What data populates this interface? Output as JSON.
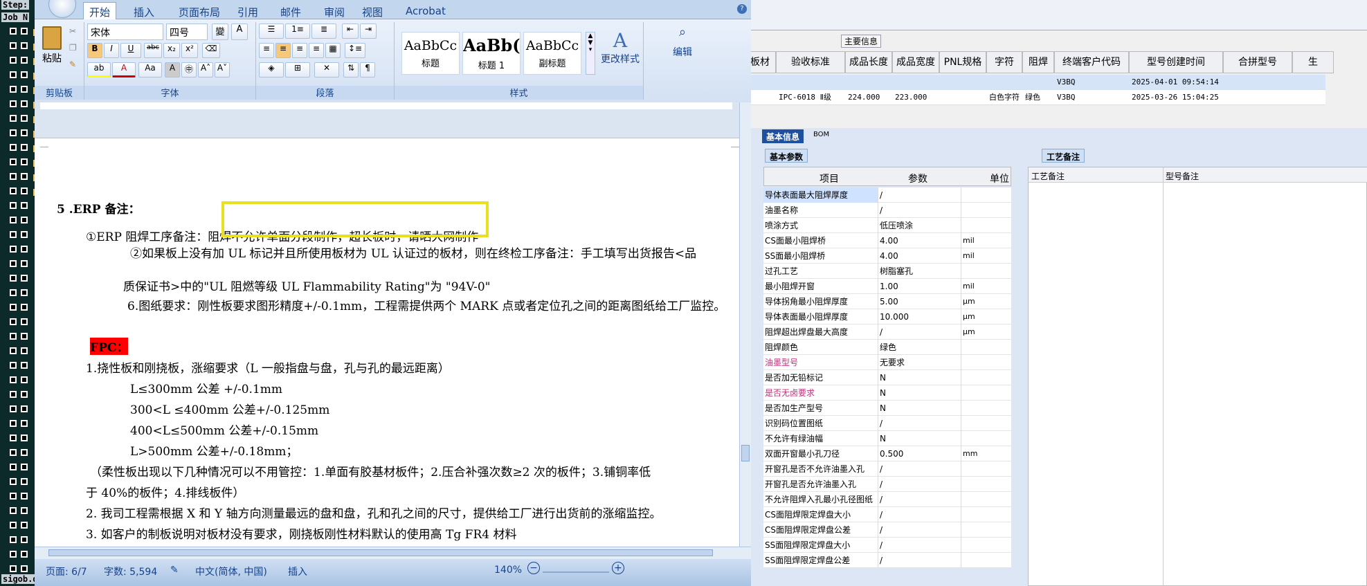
{
  "left_strip": {
    "top_label": "Step:",
    "job_label": "Job N",
    "bottom_label": "sigob.d"
  },
  "word": {
    "tabs": [
      "开始",
      "插入",
      "页面布局",
      "引用",
      "邮件",
      "审阅",
      "视图",
      "Acrobat"
    ],
    "active_tab": "开始",
    "clipboard": {
      "paste_label": "粘贴",
      "group_label": "剪贴板"
    },
    "font": {
      "family": "宋体",
      "size": "四号",
      "group_label": "字体"
    },
    "paragraph": {
      "group_label": "段落"
    },
    "styles": {
      "items": [
        {
          "sample": "AaBbCc",
          "name": "标题"
        },
        {
          "sample": "AaBb(",
          "name": "标题 1"
        },
        {
          "sample": "AaBbCc",
          "name": "副标题"
        }
      ],
      "change_label": "更改样式",
      "group_label": "样式"
    },
    "edit_label": "编辑",
    "document": {
      "lines": [
        {
          "text": "5 .ERP 备注：",
          "bold": true
        },
        {
          "text": "①ERP 阻焊工序备注：阻焊不允许单面分段制作，超长板时，请晒大网制作",
          "highlight": true
        },
        {
          "text": "②如果板上没有加 UL 标记并且所使用板材为 UL 认证过的板材，则在终检工序备注：手工填写出货报告<品"
        },
        {
          "text": "质保证书>中的\"UL 阻燃等级 UL Flammability Rating\"为 \"94V-0\""
        },
        {
          "text": "6.图纸要求：刚性板要求图形精度+/-0.1mm，工程需提供两个 MARK 点或者定位孔之间的距离图纸给工厂监控。"
        },
        {
          "text": "FPC：",
          "red": true
        },
        {
          "text": "1.挠性板和刚挠板，涨缩要求（L 一般指盘与盘，孔与孔的最远距离）"
        },
        {
          "text": "L≤300mm 公差 +/-0.1mm"
        },
        {
          "text": "300<L ≤400mm 公差+/-0.125mm"
        },
        {
          "text": "400<L≤500mm 公差+/-0.15mm"
        },
        {
          "text": "L>500mm 公差+/-0.18mm；"
        },
        {
          "text": "（柔性板出现以下几种情况可以不用管控：1.单面有胶基材板件；2.压合补强次数≥2 次的板件；3.铺铜率低"
        },
        {
          "text": "于 40%的板件；4.排线板件）"
        },
        {
          "text": "2.   我司工程需根据 X 和 Y 轴方向测量最远的盘和盘，孔和孔之间的尺寸，提供给工厂进行出货前的涨缩监控。"
        },
        {
          "text": "3. 如客户的制板说明对板材没有要求，刚挠板刚性材料默认的使用高 Tg FR4 材料"
        }
      ]
    },
    "status": {
      "page": "页面: 6/7",
      "words": "字数: 5,594",
      "lang": "中文(简体, 中国)",
      "mode": "插入",
      "zoom": "140%"
    }
  },
  "erp": {
    "section_label": "主要信息",
    "columns": [
      "板材",
      "验收标准",
      "成品长度",
      "成品宽度",
      "PNL规格",
      "字符",
      "阻焊",
      "终端客户代码",
      "型号创建时间",
      "合拼型号",
      "生"
    ],
    "rows": [
      [
        "",
        "",
        "",
        "",
        "",
        "",
        "",
        "V3BQ",
        "2025-04-01 09:54:14",
        "",
        ""
      ],
      [
        "",
        "IPC-6018 Ⅱ级",
        "224.000",
        "223.000",
        "",
        "白色字符",
        "绿色",
        "V3BQ",
        "2025-03-26 15:04:25",
        "",
        ""
      ]
    ],
    "tabs": [
      "基本信息",
      "BOM"
    ],
    "sub_tab": "基本参数",
    "craft_tab": "工艺备注",
    "craft_cols": [
      "工艺备注",
      "型号备注"
    ],
    "param_headers": [
      "项目",
      "参数",
      "单位"
    ],
    "params": [
      {
        "item": "导体表面最大阻焊厚度",
        "value": "/",
        "unit": ""
      },
      {
        "item": "油墨名称",
        "value": "/",
        "unit": ""
      },
      {
        "item": "喷涂方式",
        "value": "低压喷涂",
        "unit": ""
      },
      {
        "item": "CS面最小阻焊桥",
        "value": "4.00",
        "unit": "mil"
      },
      {
        "item": "SS面最小阻焊桥",
        "value": "4.00",
        "unit": "mil"
      },
      {
        "item": "过孔工艺",
        "value": "树脂塞孔",
        "unit": ""
      },
      {
        "item": "最小阻焊开窗",
        "value": "1.00",
        "unit": "mil"
      },
      {
        "item": "导体拐角最小阻焊厚度",
        "value": "5.00",
        "unit": "μm"
      },
      {
        "item": "导体表面最小阻焊厚度",
        "value": "10.000",
        "unit": "μm"
      },
      {
        "item": "阻焊超出焊盘最大高度",
        "value": "/",
        "unit": "μm"
      },
      {
        "item": "阻焊颜色",
        "value": "绿色",
        "unit": ""
      },
      {
        "item": "油墨型号",
        "value": "无要求",
        "unit": "",
        "pink": true
      },
      {
        "item": "是否加无铅标记",
        "value": "N",
        "unit": ""
      },
      {
        "item": "是否无卤要求",
        "value": "N",
        "unit": "",
        "pink": true
      },
      {
        "item": "是否加生产型号",
        "value": "N",
        "unit": ""
      },
      {
        "item": "识别码位置图纸",
        "value": "/",
        "unit": ""
      },
      {
        "item": "不允许有绿油幅",
        "value": "N",
        "unit": ""
      },
      {
        "item": "双面开窗最小孔刀径",
        "value": "0.500",
        "unit": "mm"
      },
      {
        "item": "开窗孔是否不允许油墨入孔",
        "value": "/",
        "unit": ""
      },
      {
        "item": "开窗孔是否允许油墨入孔",
        "value": "/",
        "unit": ""
      },
      {
        "item": "不允许阻焊入孔最小孔径图纸",
        "value": "/",
        "unit": ""
      },
      {
        "item": "CS面阻焊限定焊盘大小",
        "value": "/",
        "unit": ""
      },
      {
        "item": "CS面阻焊限定焊盘公差",
        "value": "/",
        "unit": ""
      },
      {
        "item": "SS面阻焊限定焊盘大小",
        "value": "/",
        "unit": ""
      },
      {
        "item": "SS面阻焊限定焊盘公差",
        "value": "/",
        "unit": ""
      }
    ]
  },
  "colors": {
    "highlight_box": "#e8e020",
    "fpc_red": "#ff0000",
    "ribbon_text": "#15428b"
  }
}
